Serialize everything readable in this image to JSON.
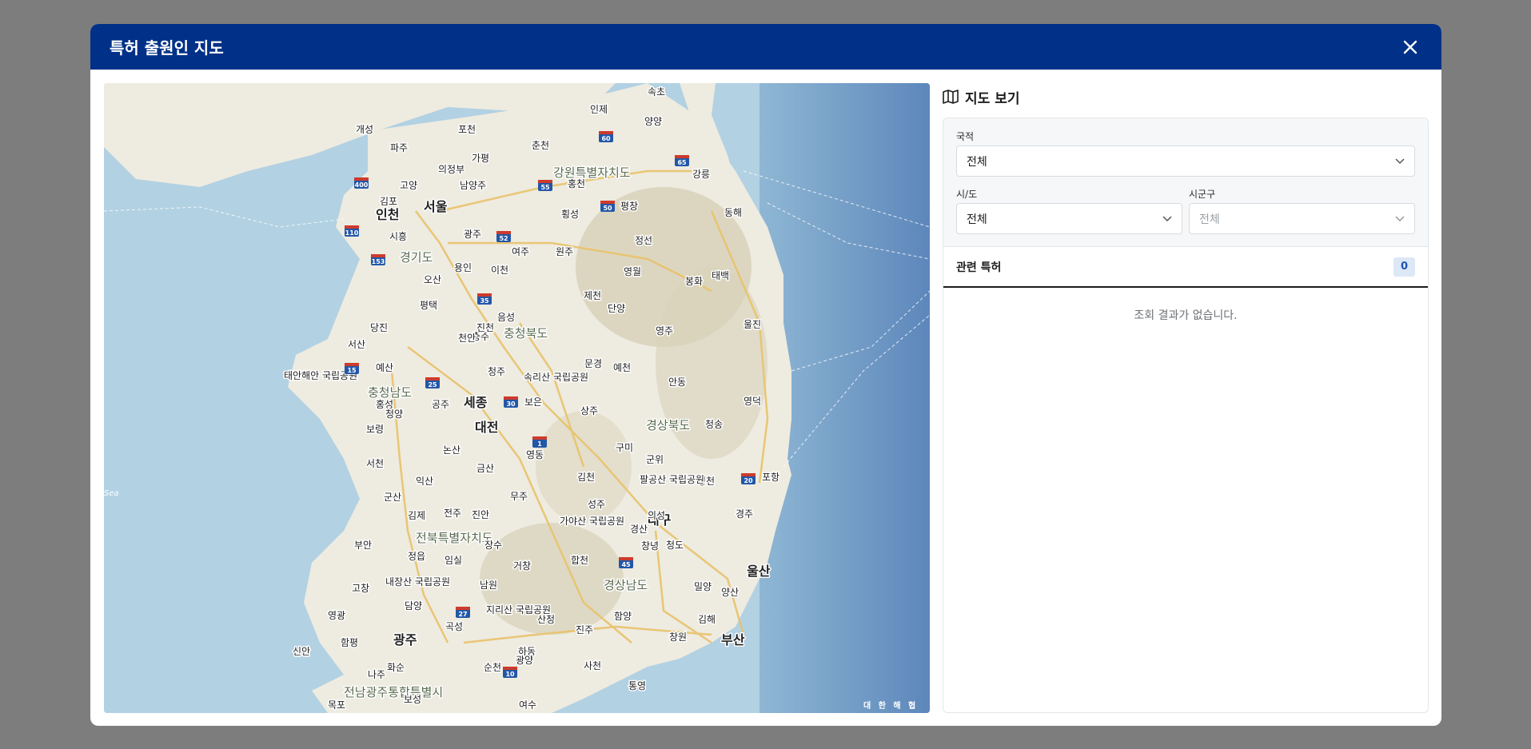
{
  "modal": {
    "title": "특허 출원인 지도",
    "close_icon": "close-icon"
  },
  "panel": {
    "title": "지도 보기",
    "title_icon": "map-icon",
    "nationality": {
      "label": "국적",
      "value": "전체"
    },
    "province": {
      "label": "시/도",
      "value": "전체"
    },
    "district": {
      "label": "시군구",
      "value": "전체"
    },
    "related": {
      "label": "관련 특허",
      "count": "0"
    },
    "empty_message": "조회 결과가 없습니다."
  },
  "map": {
    "provinces": [
      "강원특별자치도",
      "경기도",
      "충청북도",
      "충청남도",
      "경상북도",
      "전북특별자치도",
      "경상남도",
      "전남광주통합특별시"
    ],
    "major_cities": [
      "서울",
      "인천",
      "세종",
      "대전",
      "대구",
      "울산",
      "부산",
      "광주"
    ],
    "cities": [
      "개성",
      "파주",
      "포천",
      "의정부",
      "남양주",
      "춘천",
      "고양",
      "가평",
      "김포",
      "시흥",
      "광주",
      "여주",
      "원주",
      "횡성",
      "평창",
      "강릉",
      "동해",
      "태백",
      "용인",
      "이천",
      "오산",
      "평택",
      "제천",
      "단양",
      "영주",
      "충주",
      "천안",
      "당진",
      "서산",
      "예산",
      "청주",
      "공주",
      "보은",
      "문경",
      "예천",
      "안동",
      "상주",
      "홍성",
      "청양",
      "보령",
      "논산",
      "영동",
      "구미",
      "김천",
      "영천",
      "포항",
      "경주",
      "군산",
      "익산",
      "김제",
      "전주",
      "진안",
      "무주",
      "성주",
      "부안",
      "정읍",
      "임실",
      "장수",
      "거창",
      "합천",
      "창녕",
      "밀양",
      "양산",
      "김해",
      "창원",
      "진주",
      "고창",
      "영광",
      "담양",
      "남원",
      "곡성",
      "함평",
      "하동",
      "산청",
      "함양",
      "사천",
      "통영",
      "순천",
      "광양",
      "여수",
      "목포",
      "나주",
      "신안",
      "화순",
      "보성",
      "속초",
      "양양",
      "인제",
      "정선",
      "영월",
      "울진",
      "영덕",
      "청송",
      "군위",
      "봉화",
      "청도",
      "경산",
      "홍천",
      "음성",
      "진천",
      "서천",
      "금산",
      "의성"
    ],
    "parks": [
      "속리산 국립공원",
      "팔공산 국립공원",
      "가야산 국립공원",
      "내장산 국립공원",
      "지리산 국립공원",
      "태안해안 국립공원"
    ],
    "highways": [
      "400",
      "110",
      "153",
      "55",
      "60",
      "65",
      "50",
      "52",
      "35",
      "15",
      "25",
      "30",
      "1",
      "45",
      "27",
      "10",
      "20"
    ],
    "sea_labels": [
      "대 한 해 협",
      "Sea"
    ]
  },
  "colors": {
    "header_bg": "#003087",
    "backdrop": "#7d7d7d",
    "sea": "#a6c8df",
    "land": "#eeebe0"
  }
}
